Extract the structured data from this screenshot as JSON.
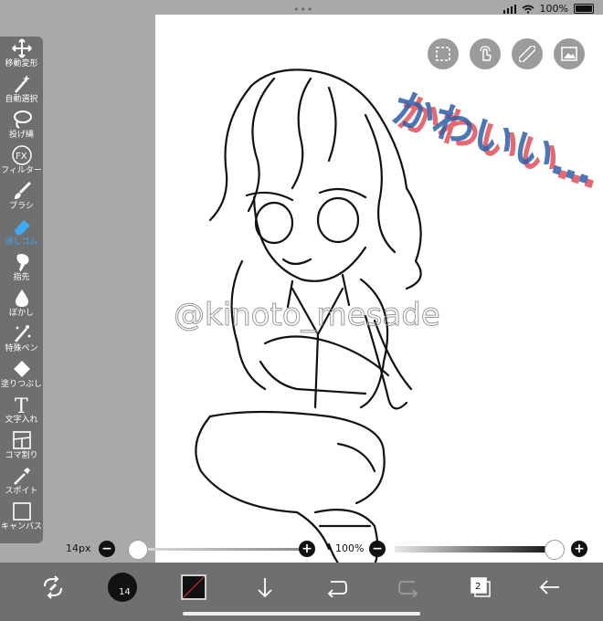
{
  "status_bar": {
    "dots": "•••",
    "battery": "100%"
  },
  "canvas": {
    "watermark": "@kinoto_mesade",
    "handwriting": "かわいい…"
  },
  "top_tools": [
    {
      "name": "selection-icon"
    },
    {
      "name": "gesture-icon"
    },
    {
      "name": "ruler-icon"
    },
    {
      "name": "image-icon"
    }
  ],
  "left_toolbar": {
    "tools": [
      {
        "label": "移動変形",
        "icon": "move-icon"
      },
      {
        "label": "自動選択",
        "icon": "magic-wand-icon"
      },
      {
        "label": "投げ縄",
        "icon": "lasso-icon"
      },
      {
        "label": "フィルター",
        "icon": "fx-icon"
      },
      {
        "label": "ブラシ",
        "icon": "brush-icon"
      },
      {
        "label": "消しゴム",
        "icon": "eraser-icon",
        "active": true
      },
      {
        "label": "指先",
        "icon": "finger-icon"
      },
      {
        "label": "ぼかし",
        "icon": "blur-icon"
      },
      {
        "label": "特殊ペン",
        "icon": "special-pen-icon"
      },
      {
        "label": "塗りつぶし",
        "icon": "fill-icon"
      },
      {
        "label": "文字入れ",
        "icon": "text-icon"
      },
      {
        "label": "コマ割り",
        "icon": "panel-icon"
      },
      {
        "label": "スポイト",
        "icon": "eyedropper-icon"
      },
      {
        "label": "キャンバス",
        "icon": "canvas-icon"
      }
    ],
    "fx_glyph": "FX",
    "text_glyph": "T"
  },
  "sliders": {
    "brush_size_label": "14px",
    "minus": "−",
    "plus": "+",
    "opacity_label": "100%"
  },
  "bottom_bar": {
    "brush_size_num": "14",
    "layer_count": "2"
  },
  "colors": {
    "accent": "#3fa9f5",
    "toolbar": "#6f6f6f",
    "bg": "#a9a9a9"
  }
}
